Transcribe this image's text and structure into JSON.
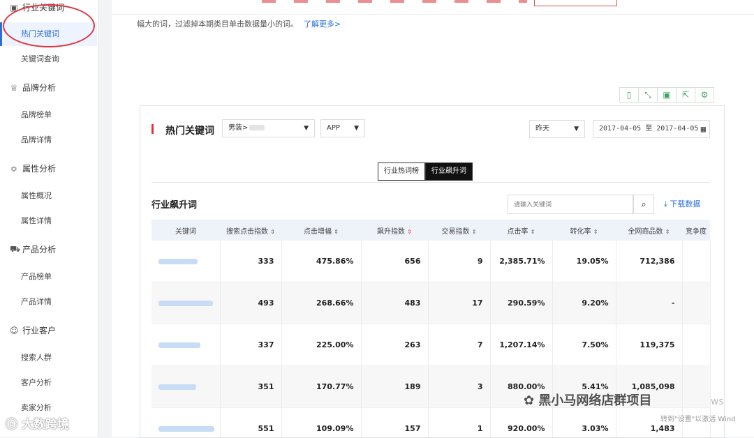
{
  "sidebar": {
    "groups": [
      {
        "label": "行业关键词",
        "icon": "document-icon",
        "items": [
          "热门关键词",
          "关键词查询"
        ]
      },
      {
        "label": "品牌分析",
        "icon": "crown-icon",
        "items": [
          "品牌榜单",
          "品牌详情"
        ]
      },
      {
        "label": "属性分析",
        "icon": "sliders-icon",
        "items": [
          "属性概况",
          "属性详情"
        ]
      },
      {
        "label": "产品分析",
        "icon": "cart-icon",
        "items": [
          "产品榜单",
          "产品详情"
        ]
      },
      {
        "label": "行业客户",
        "icon": "user-circle-icon",
        "items": [
          "搜索人群",
          "客户分析",
          "卖家分析"
        ]
      }
    ],
    "active_item": "热门关键词"
  },
  "notice": {
    "text": "幅大的词，过滤掉本期类目单击数据量小的词。",
    "link": "了解更多>"
  },
  "toolbar": {
    "icons": [
      "mobile-icon",
      "expand-icon",
      "save-icon",
      "share-icon",
      "gear-icon"
    ]
  },
  "panel": {
    "title": "热门关键词",
    "category": "男装>",
    "platform": "APP",
    "period": "昨天",
    "date_range": "2017-04-05 至 2017-04-05",
    "tabs": [
      "行业热词榜",
      "行业飙升词"
    ],
    "active_tab": "行业飙升词"
  },
  "section": {
    "title": "行业飙升词",
    "search_placeholder": "请输入关键词",
    "download_label": "下载数据"
  },
  "table": {
    "columns": [
      "关键词",
      "搜索点击指数",
      "点击增幅",
      "飙升指数",
      "交易指数",
      "点击率",
      "转化率",
      "全网商品数",
      "竞争度"
    ],
    "rows": [
      [
        "",
        "333",
        "475.86%",
        "656",
        "9",
        "2,385.71%",
        "19.05%",
        "712,386",
        ""
      ],
      [
        "",
        "493",
        "268.66%",
        "483",
        "17",
        "290.59%",
        "9.20%",
        "-",
        ""
      ],
      [
        "",
        "337",
        "225.00%",
        "263",
        "7",
        "1,207.14%",
        "7.50%",
        "119,375",
        ""
      ],
      [
        "",
        "351",
        "170.77%",
        "189",
        "3",
        "880.00%",
        "5.41%",
        "1,085,098",
        ""
      ],
      [
        "",
        "551",
        "109.09%",
        "157",
        "1",
        "920.00%",
        "3.03%",
        "1,483",
        ""
      ]
    ]
  },
  "watermarks": {
    "main": "黑小马网络店群项目",
    "left": "大数跨境",
    "win1": "转到\"设置\"以激活 Wind",
    "win2": "ws"
  }
}
